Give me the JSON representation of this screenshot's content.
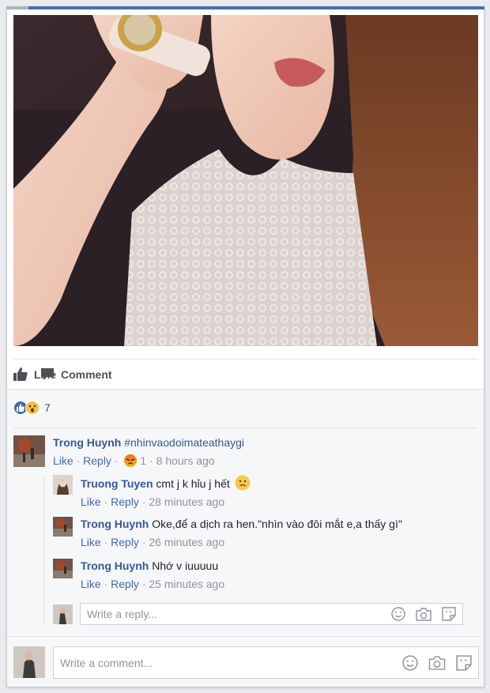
{
  "actions": {
    "like_label": "Like",
    "comment_label": "Comment"
  },
  "reactions": {
    "count": "7",
    "icons": [
      "like-icon",
      "wow-icon"
    ]
  },
  "comments": [
    {
      "author": "Trong Huynh",
      "text": "#nhinvaodoimateathaygi",
      "like": "Like",
      "reply": "Reply",
      "reaction_count": "1",
      "time": "8 hours ago",
      "replies": [
        {
          "author": "Truong Tuyen",
          "text": "cmt j k hỉu j hết",
          "like": "Like",
          "reply": "Reply",
          "time": "28 minutes ago"
        },
        {
          "author": "Trong Huynh",
          "text": "Oke,để a dịch ra hen.\"nhìn vào đôi mắt e,a thấy gì\"",
          "like": "Like",
          "reply": "Reply",
          "time": "26 minutes ago"
        },
        {
          "author": "Trong Huynh",
          "text": "Nhớ v iuuuuu",
          "like": "Like",
          "reply": "Reply",
          "time": "25 minutes ago"
        }
      ]
    }
  ],
  "reply_input": {
    "placeholder": "Write a reply..."
  },
  "comment_input": {
    "placeholder": "Write a comment..."
  },
  "sep": " · ",
  "colors": {
    "link": "#365899",
    "like_blue": "#4267b2",
    "meta": "#90949c",
    "background": "#f6f7f9"
  }
}
